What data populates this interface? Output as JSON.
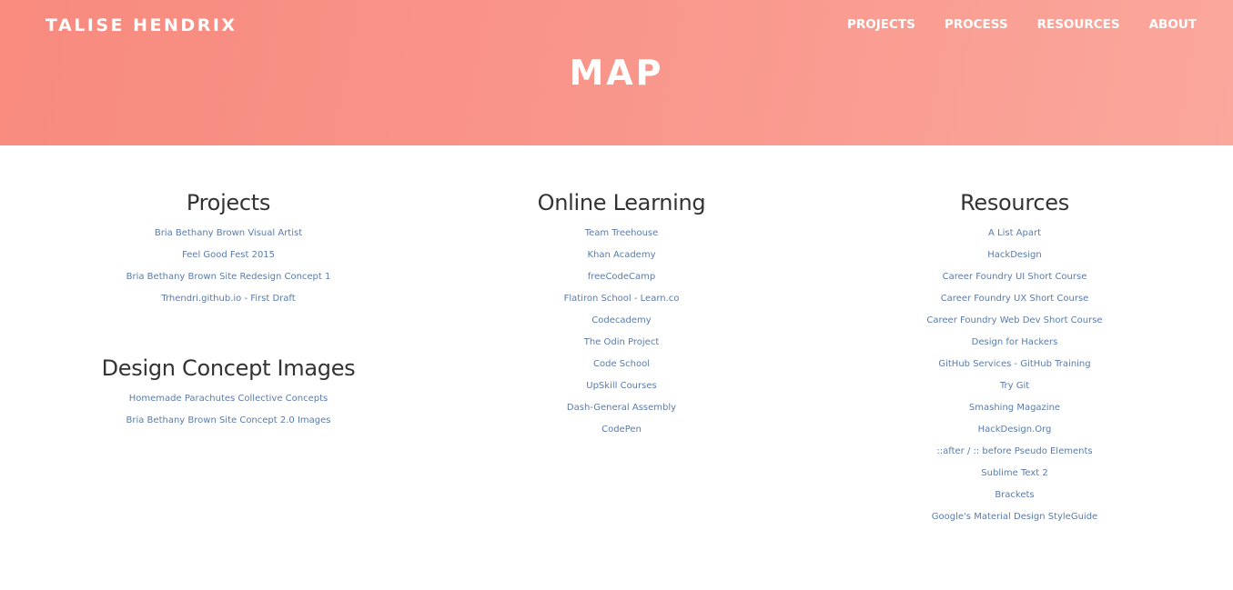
{
  "header": {
    "brand": "TALISE HENDRIX",
    "nav": [
      "PROJECTS",
      "PROCESS",
      "RESOURCES",
      "ABOUT"
    ],
    "page_title": "MAP"
  },
  "columns": {
    "projects": {
      "title": "Projects",
      "links": [
        "Bria Bethany Brown Visual Artist",
        "Feel Good Fest 2015",
        "Bria Bethany Brown Site Redesign Concept 1",
        "Trhendri.github.io - First Draft"
      ]
    },
    "design_concepts": {
      "title": "Design Concept Images",
      "links": [
        "Homemade Parachutes Collective Concepts",
        "Bria Bethany Brown Site Concept 2.0 Images"
      ]
    },
    "online_learning": {
      "title": "Online Learning",
      "links": [
        "Team Treehouse",
        "Khan Academy",
        "freeCodeCamp",
        "Flatiron School - Learn.co",
        "Codecademy",
        "The Odin Project",
        "Code School",
        "UpSkill Courses",
        "Dash-General Assembly",
        "CodePen"
      ]
    },
    "resources": {
      "title": "Resources",
      "links": [
        "A List Apart",
        "HackDesign",
        "Career Foundry UI Short Course",
        "Career Foundry UX Short Course",
        "Career Foundry Web Dev Short Course",
        "Design for Hackers",
        "GitHub Services - GitHub Training",
        "Try Git",
        "Smashing Magazine",
        "HackDesign.Org",
        "::after / :: before Pseudo Elements",
        "Sublime Text 2",
        "Brackets",
        "Google's Material Design StyleGuide"
      ]
    }
  },
  "colors": {
    "hero_start": "#f88a7e",
    "hero_end": "#fba79c",
    "link": "#5b7ba8",
    "heading": "#333333"
  }
}
